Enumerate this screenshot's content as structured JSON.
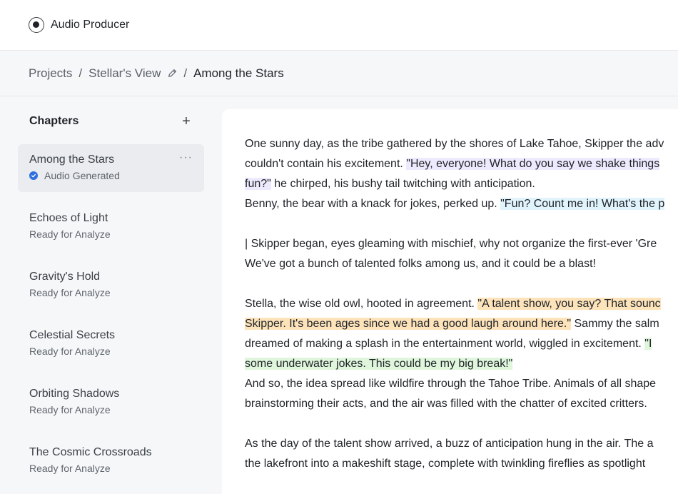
{
  "app": {
    "title": "Audio Producer",
    "logo_icon": "record-circle-icon"
  },
  "breadcrumb": {
    "items": [
      "Projects",
      "Stellar's View",
      "Among the Stars"
    ],
    "separator": "/"
  },
  "sidebar": {
    "title": "Chapters",
    "add_label": "+",
    "more_label": "···",
    "chapters": [
      {
        "title": "Among the Stars",
        "status": "Audio Generated",
        "active": true
      },
      {
        "title": "Echoes of Light",
        "status": "Ready for Analyze"
      },
      {
        "title": "Gravity's Hold",
        "status": "Ready for Analyze"
      },
      {
        "title": "Celestial Secrets",
        "status": "Ready for Analyze"
      },
      {
        "title": "Orbiting Shadows",
        "status": "Ready for Analyze"
      },
      {
        "title": "The Cosmic Crossroads",
        "status": "Ready for Analyze"
      }
    ]
  },
  "editor": {
    "colors": {
      "purple": "#eeeafd",
      "blue": "#e1f3fb",
      "orange": "#fde3ba",
      "green": "#e0f6dc"
    },
    "lines": {
      "l1": "One sunny day, as the tribe gathered by the shores of Lake Tahoe, Skipper the adv",
      "l2a": "couldn't contain his excitement. ",
      "l2b": "\"Hey, everyone! What do you say we shake things",
      "l3a": "fun?\"",
      "l3b": " he chirped, his bushy tail twitching with anticipation.",
      "l4a": "Benny, the bear with a knack for jokes, perked up. ",
      "l4b": "\"Fun? Count me in! What's the p",
      "l5": "| Skipper began, eyes gleaming with mischief, why not organize the first-ever 'Gre",
      "l6": "We've got a bunch of talented folks among us, and it could be a blast!",
      "l7a": "Stella, the wise old owl, hooted in agreement. ",
      "l7b": "\"A talent show, you say? That sounc",
      "l8a": "Skipper. It's been ages since we had a good laugh around here.\"",
      "l8b": " Sammy the salm",
      "l9a": "dreamed of making a splash in the entertainment world, wiggled in excitement. ",
      "l9b": "\"I",
      "l10": "some underwater jokes. This could be my big break!\"",
      "l11": "And so, the idea spread like wildfire through the Tahoe Tribe. Animals of all shape",
      "l12": "brainstorming their acts, and the air was filled with the chatter of excited critters.",
      "l13": "As the day of the talent show arrived, a buzz of anticipation hung in the air. The a",
      "l14": "the lakefront into a makeshift stage, complete with twinkling fireflies as spotlight"
    }
  }
}
